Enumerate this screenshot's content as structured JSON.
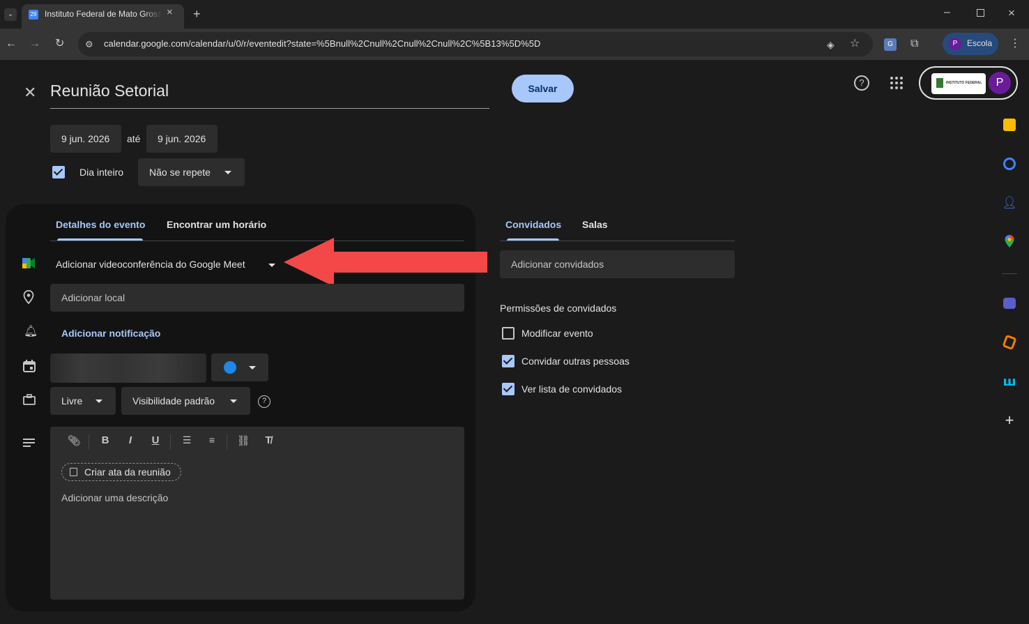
{
  "browser": {
    "tab_title": "Instituto Federal de Mato Grosso",
    "favicon_text": "29",
    "url": "calendar.google.com/calendar/u/0/r/eventedit?state=%5Bnull%2Cnull%2Cnull%2Cnull%2C%5B13%5D%5D",
    "profile_initial": "P",
    "profile_label": "Escola"
  },
  "event": {
    "title": "Reunião Setorial",
    "save_label": "Salvar",
    "start_date": "9 jun. 2026",
    "to_label": "até",
    "end_date": "9 jun. 2026",
    "all_day_label": "Dia inteiro",
    "all_day_checked": true,
    "repeat_value": "Não se repete"
  },
  "details": {
    "tabs": [
      "Detalhes do evento",
      "Encontrar um horário"
    ],
    "active_tab": 0,
    "meet_label": "Adicionar videoconferência do Google Meet",
    "location_placeholder": "Adicionar local",
    "add_notification": "Adicionar notificação",
    "event_color": "#1e88e5",
    "availability": "Livre",
    "visibility": "Visibilidade padrão",
    "create_notes": "Criar ata da reunião",
    "description_placeholder": "Adicionar uma descrição"
  },
  "guests": {
    "tabs": [
      "Convidados",
      "Salas"
    ],
    "active_tab": 0,
    "add_placeholder": "Adicionar convidados",
    "permissions_title": "Permissões de convidados",
    "permissions": [
      {
        "label": "Modificar evento",
        "checked": false
      },
      {
        "label": "Convidar outras pessoas",
        "checked": true
      },
      {
        "label": "Ver lista de convidados",
        "checked": true
      }
    ]
  },
  "header": {
    "org_logo_text": "INSTITUTO FEDERAL",
    "account_initial": "P"
  },
  "annotation": {
    "arrow_color": "#f44848"
  },
  "colors": {
    "accent": "#a8c7fa",
    "background": "#1b1b1b"
  }
}
